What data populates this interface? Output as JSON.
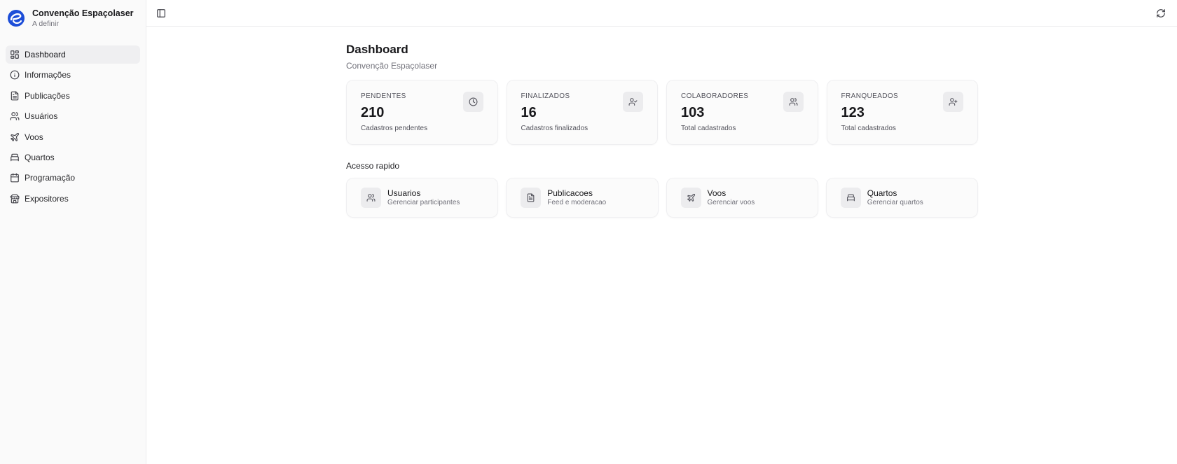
{
  "app": {
    "name": "Convenção Espaçolaser",
    "subtitle": "A definir",
    "brand_color": "#1d4ed8"
  },
  "sidebar": {
    "items": [
      {
        "label": "Dashboard",
        "icon": "layout-grid-icon",
        "active": true
      },
      {
        "label": "Informações",
        "icon": "info-icon",
        "active": false
      },
      {
        "label": "Publicações",
        "icon": "file-text-icon",
        "active": false
      },
      {
        "label": "Usuários",
        "icon": "users-icon",
        "active": false
      },
      {
        "label": "Voos",
        "icon": "plane-icon",
        "active": false
      },
      {
        "label": "Quartos",
        "icon": "bed-icon",
        "active": false
      },
      {
        "label": "Programação",
        "icon": "calendar-icon",
        "active": false
      },
      {
        "label": "Expositores",
        "icon": "store-icon",
        "active": false
      }
    ]
  },
  "topbar": {
    "toggle_icon": "panel-left-icon",
    "refresh_icon": "refresh-icon"
  },
  "main": {
    "title": "Dashboard",
    "subtitle": "Convenção Espaçolaser",
    "stats": [
      {
        "label": "PENDENTES",
        "value": "210",
        "description": "Cadastros pendentes",
        "icon": "clock-icon"
      },
      {
        "label": "FINALIZADOS",
        "value": "16",
        "description": "Cadastros finalizados",
        "icon": "user-check-icon"
      },
      {
        "label": "COLABORADORES",
        "value": "103",
        "description": "Total cadastrados",
        "icon": "users-icon"
      },
      {
        "label": "FRANQUEADOS",
        "value": "123",
        "description": "Total cadastrados",
        "icon": "user-plus-icon"
      }
    ],
    "quick_access_title": "Acesso rapido",
    "quick_access": [
      {
        "title": "Usuarios",
        "description": "Gerenciar participantes",
        "icon": "users-icon"
      },
      {
        "title": "Publicacoes",
        "description": "Feed e moderacao",
        "icon": "file-text-icon"
      },
      {
        "title": "Voos",
        "description": "Gerenciar voos",
        "icon": "plane-icon"
      },
      {
        "title": "Quartos",
        "description": "Gerenciar quartos",
        "icon": "bed-icon"
      }
    ]
  }
}
